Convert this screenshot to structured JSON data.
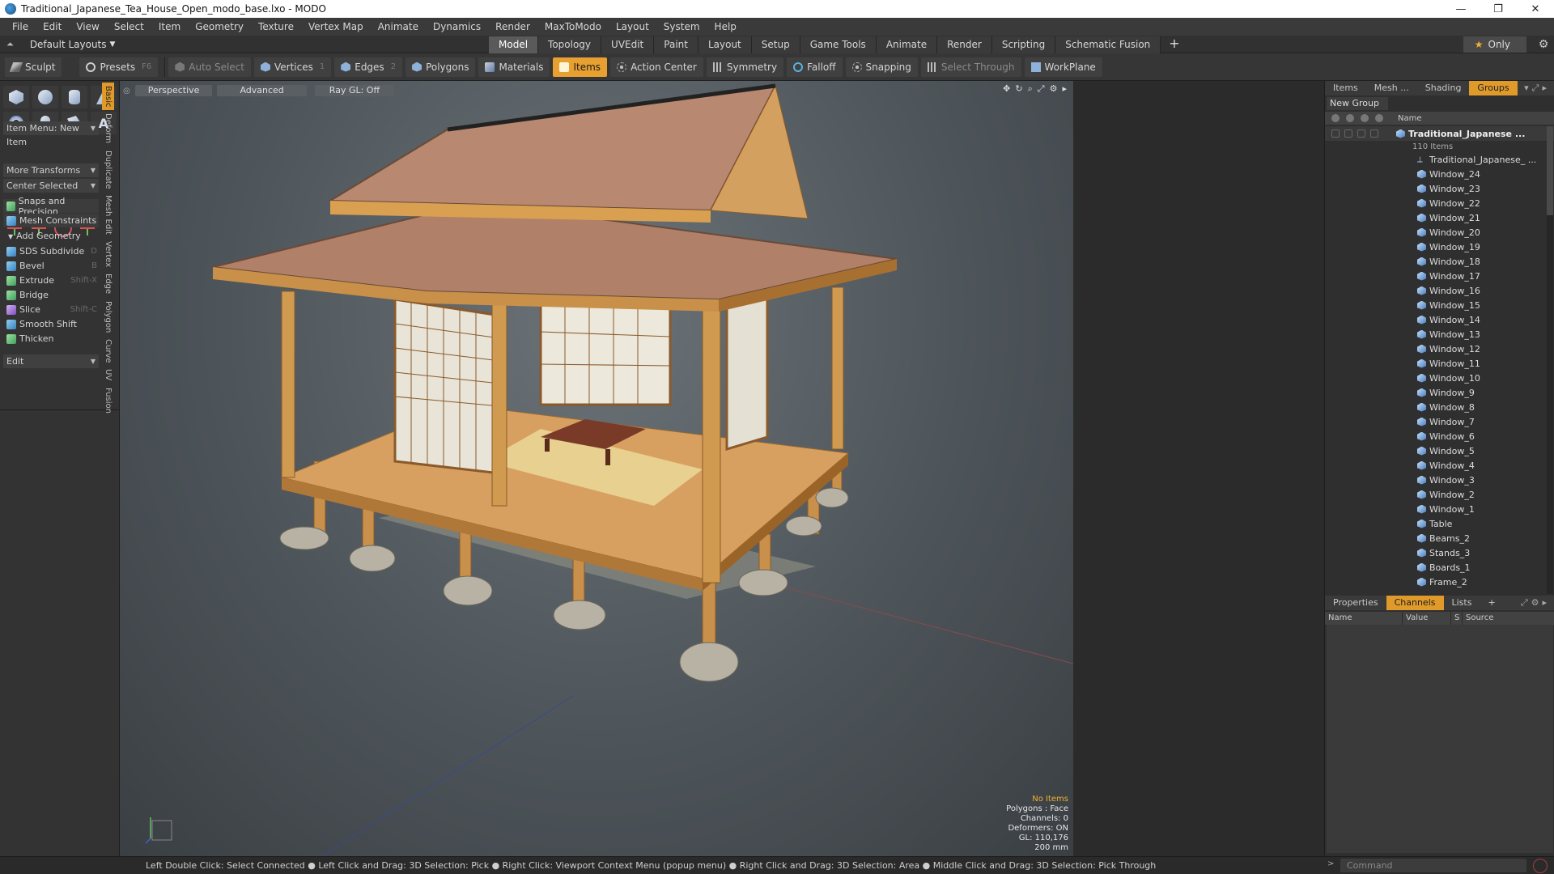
{
  "window": {
    "title": "Traditional_Japanese_Tea_House_Open_modo_base.lxo - MODO",
    "minimize": "—",
    "maximize": "❐",
    "close": "✕"
  },
  "menubar": [
    "File",
    "Edit",
    "View",
    "Select",
    "Item",
    "Geometry",
    "Texture",
    "Vertex Map",
    "Animate",
    "Dynamics",
    "Render",
    "MaxToModo",
    "Layout",
    "System",
    "Help"
  ],
  "layoutbar": {
    "layout_menu": "Default Layouts",
    "tabs": [
      "Model",
      "Topology",
      "UVEdit",
      "Paint",
      "Layout",
      "Setup",
      "Game Tools",
      "Animate",
      "Render",
      "Scripting",
      "Schematic Fusion"
    ],
    "active_tab": "Model",
    "add": "+",
    "only_label": "Only"
  },
  "toolbar": {
    "sculpt": "Sculpt",
    "presets": "Presets",
    "presets_key": "F6",
    "auto_select": "Auto Select",
    "vertices": "Vertices",
    "vertices_count": "1",
    "edges": "Edges",
    "edges_count": "2",
    "polygons": "Polygons",
    "materials": "Materials",
    "items": "Items",
    "action_center": "Action Center",
    "symmetry": "Symmetry",
    "falloff": "Falloff",
    "snapping": "Snapping",
    "select_through": "Select Through",
    "workplane": "WorkPlane"
  },
  "leftpanel": {
    "item_menu": "Item Menu: New Item",
    "more_transforms": "More Transforms",
    "center_selected": "Center Selected",
    "snaps": "Snaps and Precision",
    "mesh_constraints": "Mesh Constraints",
    "add_geometry": "Add Geometry",
    "tools": [
      {
        "label": "SDS Subdivide",
        "key": "D"
      },
      {
        "label": "Bevel",
        "key": "B"
      },
      {
        "label": "Extrude",
        "key": "Shift-X"
      },
      {
        "label": "Bridge",
        "key": ""
      },
      {
        "label": "Slice",
        "key": "Shift-C"
      },
      {
        "label": "Smooth Shift",
        "key": ""
      },
      {
        "label": "Thicken",
        "key": ""
      }
    ],
    "edit_dropdown": "Edit",
    "vtabs": [
      "Basic",
      "Deform",
      "Duplicate",
      "Mesh Edit",
      "Vertex",
      "Edge",
      "Polygon",
      "Curve",
      "UV",
      "Fusion"
    ]
  },
  "viewport": {
    "perspective": "Perspective",
    "advanced": "Advanced",
    "raygl": "Ray GL: Off",
    "info": {
      "no_items": "No Items",
      "polygons": "Polygons : Face",
      "channels": "Channels: 0",
      "deformers": "Deformers: ON",
      "gl": "GL: 110,176",
      "scale": "200 mm"
    }
  },
  "rightpanel": {
    "tabs": [
      "Items",
      "Mesh ...",
      "Shading",
      "Groups"
    ],
    "active_tab": "Groups",
    "new_group": "New Group",
    "name_header": "Name",
    "group_name": "Traditional_Japanese ...",
    "group_count": "110 Items",
    "items": [
      "Traditional_Japanese_ ...",
      "Window_24",
      "Window_23",
      "Window_22",
      "Window_21",
      "Window_20",
      "Window_19",
      "Window_18",
      "Window_17",
      "Window_16",
      "Window_15",
      "Window_14",
      "Window_13",
      "Window_12",
      "Window_11",
      "Window_10",
      "Window_9",
      "Window_8",
      "Window_7",
      "Window_6",
      "Window_5",
      "Window_4",
      "Window_3",
      "Window_2",
      "Window_1",
      "Table",
      "Beams_2",
      "Stands_3",
      "Boards_1",
      "Frame_2"
    ],
    "lower_tabs": [
      "Properties",
      "Channels",
      "Lists",
      "+"
    ],
    "lower_active": "Channels",
    "channel_headers": [
      "Name",
      "Value",
      "S",
      "Source"
    ]
  },
  "statusbar": {
    "hint": "Left Double Click: Select Connected ● Left Click and Drag: 3D Selection: Pick ● Right Click: Viewport Context Menu (popup menu) ● Right Click and Drag: 3D Selection: Area ● Middle Click and Drag: 3D Selection: Pick Through",
    "command_placeholder": "Command"
  },
  "colors": {
    "accent": "#e09a2a",
    "viewport_bg": "#4e555a",
    "panel_bg": "#333333"
  }
}
